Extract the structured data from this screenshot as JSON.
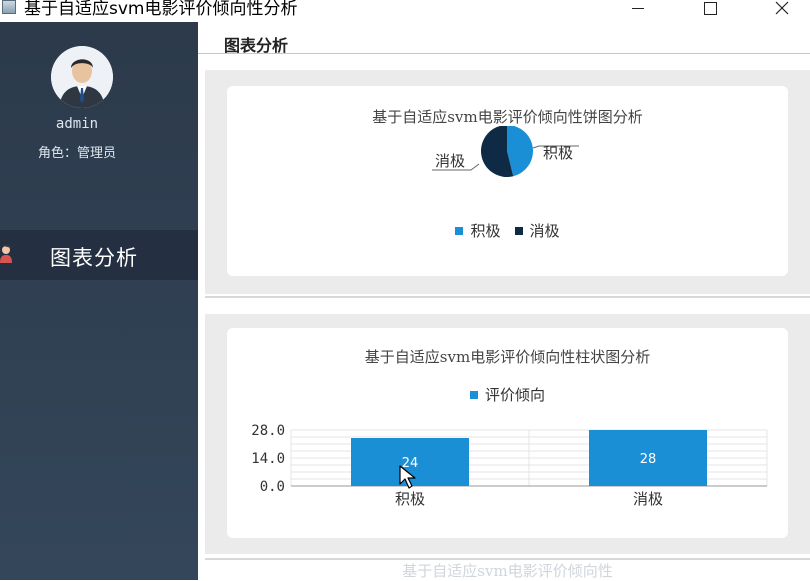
{
  "window": {
    "title": "基于自适应svm电影评价倾向性分析",
    "min_glyph": "–",
    "close_glyph": "✕"
  },
  "sidebar": {
    "username": "admin",
    "role": "角色：管理员",
    "nav": [
      {
        "label": "图表分析",
        "icon": "user-icon"
      }
    ]
  },
  "main": {
    "title": "图表分析"
  },
  "pie_chart": {
    "title": "基于自适应svm电影评价倾向性饼图分析",
    "labels": {
      "positive": "积极",
      "negative": "消极"
    },
    "legend": [
      "积极",
      "消极"
    ]
  },
  "bar_chart": {
    "title": "基于自适应svm电影评价倾向性柱状图分析",
    "legend": [
      "评价倾向"
    ],
    "tick_labels": [
      "28.0",
      "14.0",
      "0.0"
    ]
  },
  "bottom_chart": {
    "title": "基于自适应svm电影评价倾向性"
  },
  "colors": {
    "positive": "#1b8fd6",
    "negative": "#0f2a45",
    "sidebar": "#2c3a4b"
  },
  "chart_data": [
    {
      "type": "pie",
      "title": "基于自适应svm电影评价倾向性饼图分析",
      "categories": [
        "积极",
        "消极"
      ],
      "values": [
        24,
        28
      ],
      "legend_position": "bottom"
    },
    {
      "type": "bar",
      "title": "基于自适应svm电影评价倾向性柱状图分析",
      "categories": [
        "积极",
        "消极"
      ],
      "series": [
        {
          "name": "评价倾向",
          "values": [
            24,
            28
          ]
        }
      ],
      "ylim": [
        0,
        28
      ],
      "yticks": [
        0,
        14,
        28
      ],
      "data_labels": true,
      "grid": true,
      "legend_position": "top"
    }
  ]
}
